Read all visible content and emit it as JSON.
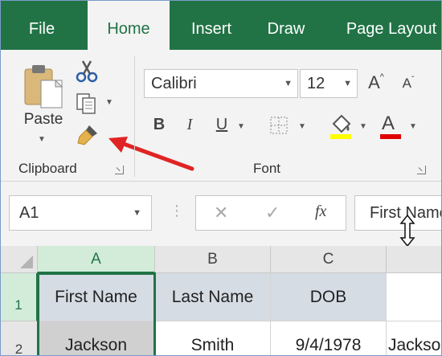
{
  "tabs": [
    {
      "label": "File"
    },
    {
      "label": "Home"
    },
    {
      "label": "Insert"
    },
    {
      "label": "Draw"
    },
    {
      "label": "Page Layout"
    }
  ],
  "clipboard": {
    "paste_label": "Paste",
    "group_label": "Clipboard"
  },
  "font": {
    "name": "Calibri",
    "size": "12",
    "group_label": "Font",
    "bold": "B",
    "italic": "I",
    "underline": "U",
    "grow": "A",
    "shrink": "A",
    "font_color": "A"
  },
  "formula_bar": {
    "name_box": "A1",
    "fx": "fx",
    "cancel": "✕",
    "enter": "✓",
    "formula": "First Name"
  },
  "sheet": {
    "columns": [
      "A",
      "B",
      "C"
    ],
    "rows": [
      "1",
      "2"
    ],
    "cells": [
      [
        "First Name",
        "Last Name",
        "DOB"
      ],
      [
        "Jackson",
        "Smith",
        "9/4/1978",
        "Jackson"
      ]
    ]
  },
  "colors": {
    "ribbon_green": "#217346",
    "annotation_arrow": "#e02424",
    "highlight": "#ffff00",
    "font_color_bar": "#e00000"
  }
}
